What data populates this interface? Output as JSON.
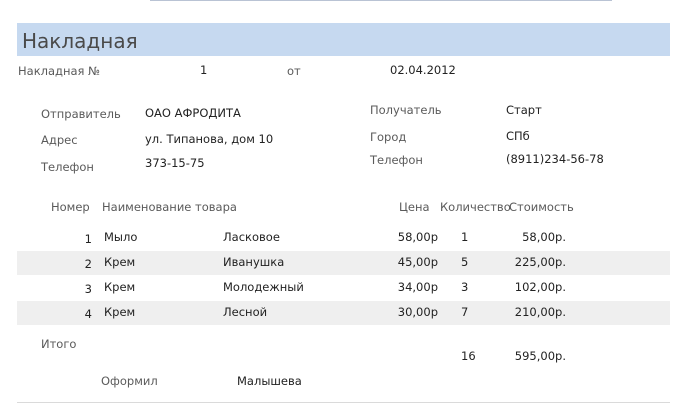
{
  "report": {
    "title": "Накладная",
    "number_label": "Накладная №",
    "number": "1",
    "date_label": "от",
    "date": "02.04.2012"
  },
  "sender": {
    "label": "Отправитель",
    "name": "ОАО АФРОДИТА",
    "address_label": "Адрес",
    "address": "ул. Типанова, дом 10",
    "phone_label": "Телефон",
    "phone": "373-15-75"
  },
  "recipient": {
    "label": "Получатель",
    "name": "Старт",
    "city_label": "Город",
    "city": "СПб",
    "phone_label": "Телефон",
    "phone": "(8911)234-56-78"
  },
  "table": {
    "headers": {
      "number": "Номер",
      "name": "Наименование товара",
      "price": "Цена",
      "qty": "Количество",
      "cost": "Стоимость"
    },
    "rows": [
      {
        "num": "1",
        "product": "Мыло",
        "brand": "Ласковое",
        "price": "58,00р",
        "qty": "1",
        "cost": "58,00р."
      },
      {
        "num": "2",
        "product": "Крем",
        "brand": "Иванушка",
        "price": "45,00р",
        "qty": "5",
        "cost": "225,00р."
      },
      {
        "num": "3",
        "product": "Крем",
        "brand": "Молодежный",
        "price": "34,00р",
        "qty": "3",
        "cost": "102,00р."
      },
      {
        "num": "4",
        "product": "Крем",
        "brand": "Лесной",
        "price": "30,00р",
        "qty": "7",
        "cost": "210,00р."
      }
    ]
  },
  "totals": {
    "label": "Итого",
    "qty": "16",
    "cost": "595,00р."
  },
  "footer": {
    "issued_label": "Оформил",
    "issued_by": "Малышева"
  }
}
